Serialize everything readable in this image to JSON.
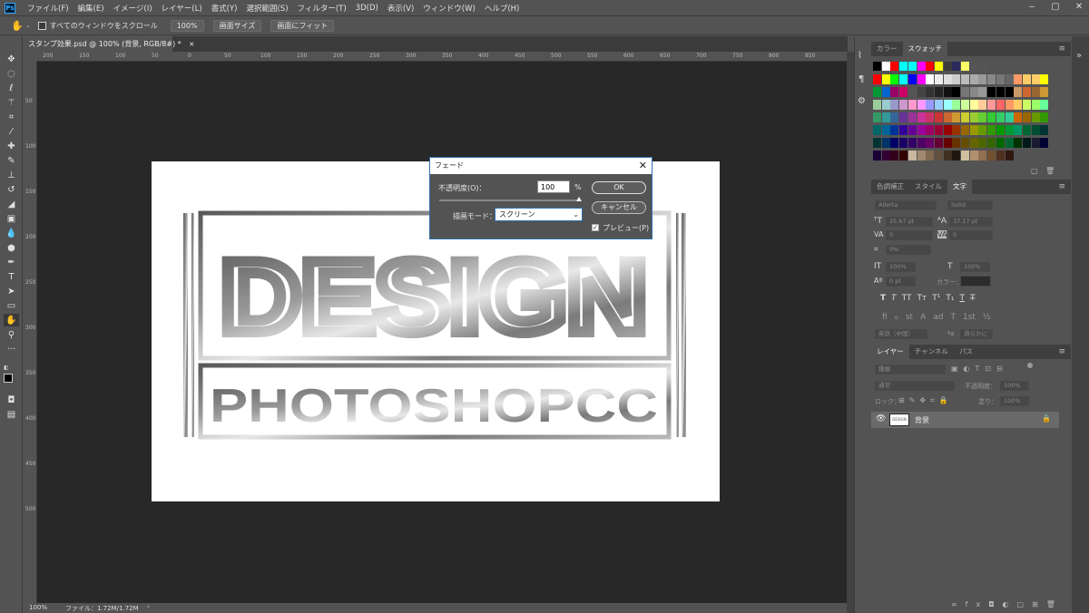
{
  "app": {
    "logo": "Ps"
  },
  "menu": [
    "ファイル(F)",
    "編集(E)",
    "イメージ(I)",
    "レイヤー(L)",
    "書式(Y)",
    "選択範囲(S)",
    "フィルター(T)",
    "3D(D)",
    "表示(V)",
    "ウィンドウ(W)",
    "ヘルプ(H)"
  ],
  "window_controls": {
    "minimize": "‒",
    "maximize": "▢",
    "close": "✕"
  },
  "options_bar": {
    "scroll_all": "すべてのウィンドウをスクロール",
    "zoom": "100%",
    "fit_screen": "画面サイズ",
    "fill_screen": "画面にフィット"
  },
  "document": {
    "tab_title": "スタンプ効果.psd @ 100% (背景, RGB/8#) *",
    "tab_close": "✕",
    "art_title": "DESIGN",
    "art_subtitle": "PHOTOSHOPCC"
  },
  "ruler": {
    "h_ticks": [
      "200",
      "150",
      "100",
      "50",
      "0",
      "50",
      "100",
      "150",
      "200",
      "250",
      "300",
      "350",
      "400",
      "450",
      "500",
      "550",
      "600",
      "650",
      "700",
      "750",
      "800",
      "850"
    ],
    "v_ticks": [
      "50",
      "100",
      "150",
      "200",
      "250",
      "300",
      "350",
      "400",
      "450",
      "500"
    ]
  },
  "status": {
    "zoom": "100%",
    "file": "ファイル：1.72M/1.72M",
    "arrow": "›"
  },
  "fade_dialog": {
    "title": "フェード",
    "close": "✕",
    "opacity_label": "不透明度(O)：",
    "opacity_value": "100",
    "percent": "%",
    "mode_label": "描画モード：",
    "mode_value": "スクリーン",
    "ok": "OK",
    "cancel": "キャンセル",
    "preview": "プレビュー(P)",
    "preview_checked": true
  },
  "swatches_panel": {
    "tabs": [
      "カラー",
      "スウォッチ"
    ],
    "active": 1,
    "menu": "≡"
  },
  "type_panel": {
    "tabs": [
      "色調補正",
      "スタイル",
      "文字"
    ],
    "active": 2,
    "font_family": "Allerta",
    "font_style": "Solid",
    "size": "25.67 pt",
    "leading": "37.17 pt",
    "kerning": "0",
    "tracking": "0",
    "vscale_pct": "0%",
    "vscale": "100%",
    "hscale": "100%",
    "baseline": "0 pt",
    "color_label": "カラー：",
    "language": "英語（中国）",
    "antialias": "滑らかに",
    "aa_icon": "ªa",
    "styles": [
      "T",
      "T",
      "TT",
      "Tт",
      "T¹",
      "T₁",
      "T",
      "T̶"
    ],
    "ot": [
      "fi",
      "ℴ",
      "st",
      "A",
      "ad",
      "T",
      "1st",
      "½"
    ]
  },
  "layers_panel": {
    "tabs": [
      "レイヤー",
      "チャンネル",
      "パス"
    ],
    "active": 0,
    "filter": "種類",
    "blend": "通常",
    "opacity_label": "不透明度：",
    "opacity": "100%",
    "lock_label": "ロック：",
    "fill_label": "塗り：",
    "fill": "100%",
    "layer_name": "背景",
    "layer_thumb": "DESIGN"
  }
}
